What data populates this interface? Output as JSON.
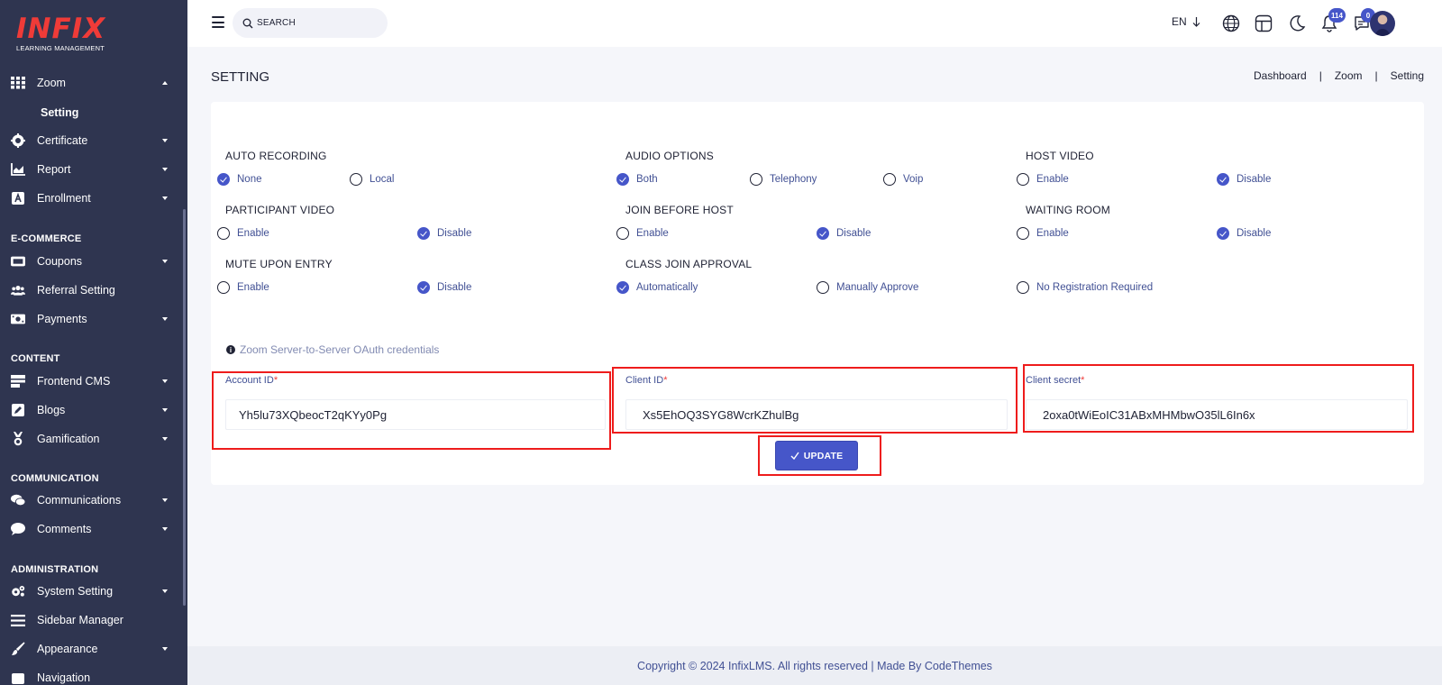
{
  "logo": {
    "name": "INFIX",
    "tagline": "LEARNING MANAGEMENT"
  },
  "sidebar": {
    "zoom": "Zoom",
    "zoom_sub": "Setting",
    "certificate": "Certificate",
    "report": "Report",
    "enrollment": "Enrollment",
    "section_ecommerce": "E-COMMERCE",
    "coupons": "Coupons",
    "referral": "Referral Setting",
    "payments": "Payments",
    "section_content": "CONTENT",
    "frontend_cms": "Frontend CMS",
    "blogs": "Blogs",
    "gamification": "Gamification",
    "section_communication": "COMMUNICATION",
    "communications": "Communications",
    "comments": "Comments",
    "section_administration": "ADMINISTRATION",
    "system_setting": "System Setting",
    "sidebar_manager": "Sidebar Manager",
    "appearance": "Appearance",
    "next_cut": "Navigation"
  },
  "header": {
    "search_placeholder": "SEARCH",
    "language": "EN",
    "notification_count": "114",
    "message_count": "0"
  },
  "page": {
    "title": "SETTING",
    "breadcrumb": [
      "Dashboard",
      "Zoom",
      "Setting"
    ]
  },
  "settings": {
    "auto_recording": {
      "title": "AUTO RECORDING",
      "options": [
        "None",
        "Local"
      ],
      "selected": "None"
    },
    "audio_options": {
      "title": "AUDIO OPTIONS",
      "options": [
        "Both",
        "Telephony",
        "Voip"
      ],
      "selected": "Both"
    },
    "host_video": {
      "title": "HOST VIDEO",
      "options": [
        "Enable",
        "Disable"
      ],
      "selected": "Disable"
    },
    "participant_video": {
      "title": "PARTICIPANT VIDEO",
      "options": [
        "Enable",
        "Disable"
      ],
      "selected": "Disable"
    },
    "join_before_host": {
      "title": "JOIN BEFORE HOST",
      "options": [
        "Enable",
        "Disable"
      ],
      "selected": "Disable"
    },
    "waiting_room": {
      "title": "WAITING ROOM",
      "options": [
        "Enable",
        "Disable"
      ],
      "selected": "Disable"
    },
    "mute_upon_entry": {
      "title": "MUTE UPON ENTRY",
      "options": [
        "Enable",
        "Disable"
      ],
      "selected": "Disable"
    },
    "class_join_approval": {
      "title": "CLASS JOIN APPROVAL",
      "options": [
        "Automatically",
        "Manually Approve",
        "No Registration Required"
      ],
      "selected": "Automatically"
    }
  },
  "credentials": {
    "info": "Zoom Server-to-Server OAuth credentials",
    "account_id_label": "Account ID",
    "account_id_value": "Yh5lu73XQbeocT2qKYy0Pg",
    "client_id_label": "Client ID",
    "client_id_value": "Xs5EhOQ3SYG8WcrKZhulBg",
    "client_secret_label": "Client secret",
    "client_secret_value": "2oxa0tWiEoIC31ABxMHMbwO35lL6In6x",
    "required_mark": "*"
  },
  "actions": {
    "update_label": "UPDATE",
    "update_icon": "check-icon"
  },
  "footer": {
    "text": "Copyright © 2024 InfixLMS. All rights reserved | Made By CodeThemes"
  },
  "colors": {
    "primary": "#4656c9",
    "sidebar": "#2f3550",
    "highlight": "#ee1c1c",
    "brand": "#ef3b38"
  }
}
